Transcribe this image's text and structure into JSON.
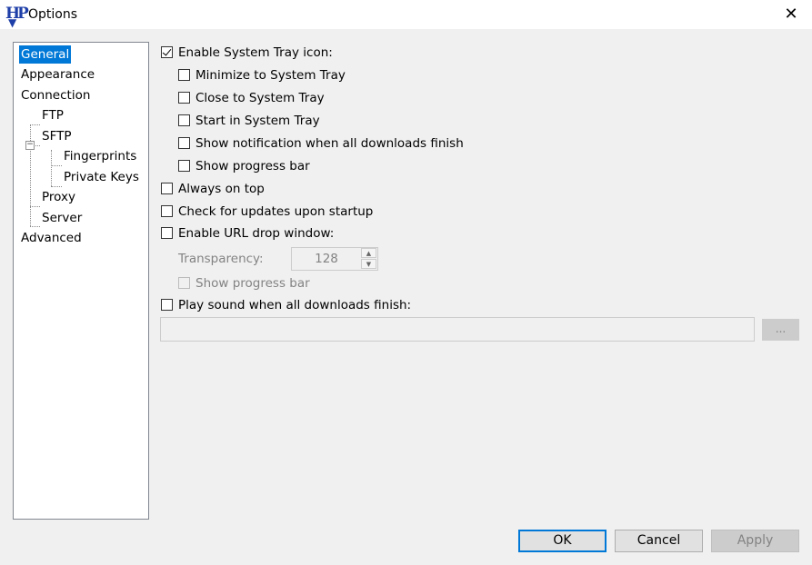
{
  "window": {
    "title": "Options",
    "app_icon": "HP"
  },
  "tree": {
    "items": [
      {
        "label": "General"
      },
      {
        "label": "Appearance"
      },
      {
        "label": "Connection"
      },
      {
        "label": "FTP"
      },
      {
        "label": "SFTP"
      },
      {
        "label": "Fingerprints"
      },
      {
        "label": "Private Keys"
      },
      {
        "label": "Proxy"
      },
      {
        "label": "Server"
      },
      {
        "label": "Advanced"
      }
    ],
    "selected": "General"
  },
  "general": {
    "tray_icon": {
      "label": "Enable System Tray icon:",
      "checked": true
    },
    "minimize_tray": {
      "label": "Minimize to System Tray",
      "checked": false
    },
    "close_tray": {
      "label": "Close to System Tray",
      "checked": false
    },
    "start_tray": {
      "label": "Start in System Tray",
      "checked": false
    },
    "show_notification": {
      "label": "Show notification when all downloads finish",
      "checked": false
    },
    "show_progress_tray": {
      "label": "Show progress bar",
      "checked": false
    },
    "always_on_top": {
      "label": "Always on top",
      "checked": false
    },
    "check_updates": {
      "label": "Check for updates upon startup",
      "checked": false
    },
    "url_drop": {
      "label": "Enable URL drop window:",
      "checked": false
    },
    "transparency_label": "Transparency:",
    "transparency_value": "128",
    "show_progress_drop": {
      "label": "Show progress bar",
      "checked": false
    },
    "play_sound": {
      "label": "Play sound when all downloads finish:",
      "checked": false
    },
    "sound_path": "",
    "browse_label": "..."
  },
  "buttons": {
    "ok": "OK",
    "cancel": "Cancel",
    "apply": "Apply"
  }
}
